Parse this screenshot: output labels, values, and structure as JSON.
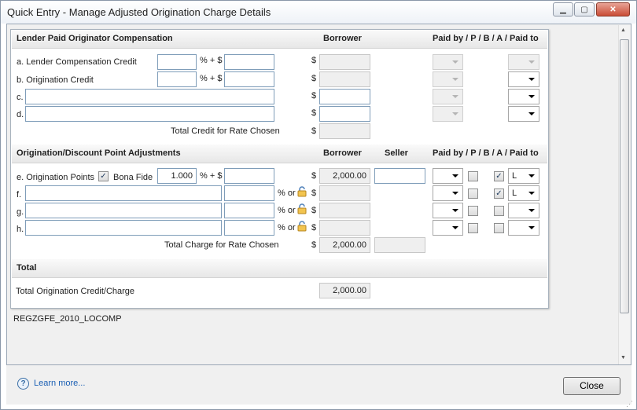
{
  "window": {
    "title": "Quick Entry - Manage Adjusted Origination Charge Details"
  },
  "lender_section": {
    "heading": "Lender Paid Originator Compensation",
    "borrower_col": "Borrower",
    "paid_by_col": "Paid by / P / B / A / Paid to",
    "rows": [
      {
        "label": "a. Lender Compensation Credit",
        "pct_sep": "% + $",
        "currency": "$"
      },
      {
        "label": "b. Origination Credit",
        "pct_sep": "% + $",
        "currency": "$"
      },
      {
        "label": "c.",
        "currency": "$"
      },
      {
        "label": "d.",
        "currency": "$"
      }
    ],
    "total_label": "Total Credit for Rate Chosen",
    "total_currency": "$"
  },
  "orig_section": {
    "heading": "Origination/Discount Point Adjustments",
    "borrower_col": "Borrower",
    "seller_col": "Seller",
    "paid_by_col": "Paid by / P / B / A / Paid to",
    "row_e": {
      "label": "e. Origination Points",
      "bona_fide_label": "Bona Fide",
      "bona_fide_checked": true,
      "points": "1.000",
      "pct_sep": "% + $",
      "currency": "$",
      "borrower": "2,000.00",
      "a_checked": true,
      "paid_to": "L"
    },
    "row_f": {
      "label": "f.",
      "pct_or": "% or",
      "currency": "$",
      "a_checked": true,
      "paid_to": "L"
    },
    "row_g": {
      "label": "g.",
      "pct_or": "% or",
      "currency": "$"
    },
    "row_h": {
      "label": "h.",
      "pct_or": "% or",
      "currency": "$"
    },
    "total_label": "Total Charge for Rate Chosen",
    "total_currency": "$",
    "total_borrower": "2,000.00"
  },
  "total_section": {
    "heading": "Total",
    "label": "Total Origination Credit/Charge",
    "value": "2,000.00"
  },
  "status_code": "REGZGFE_2010_LOCOMP",
  "footer": {
    "learn_more": "Learn more...",
    "close_label": "Close"
  },
  "icons": {
    "help": "help-icon",
    "lock": "unlocked-padlock-icon"
  }
}
